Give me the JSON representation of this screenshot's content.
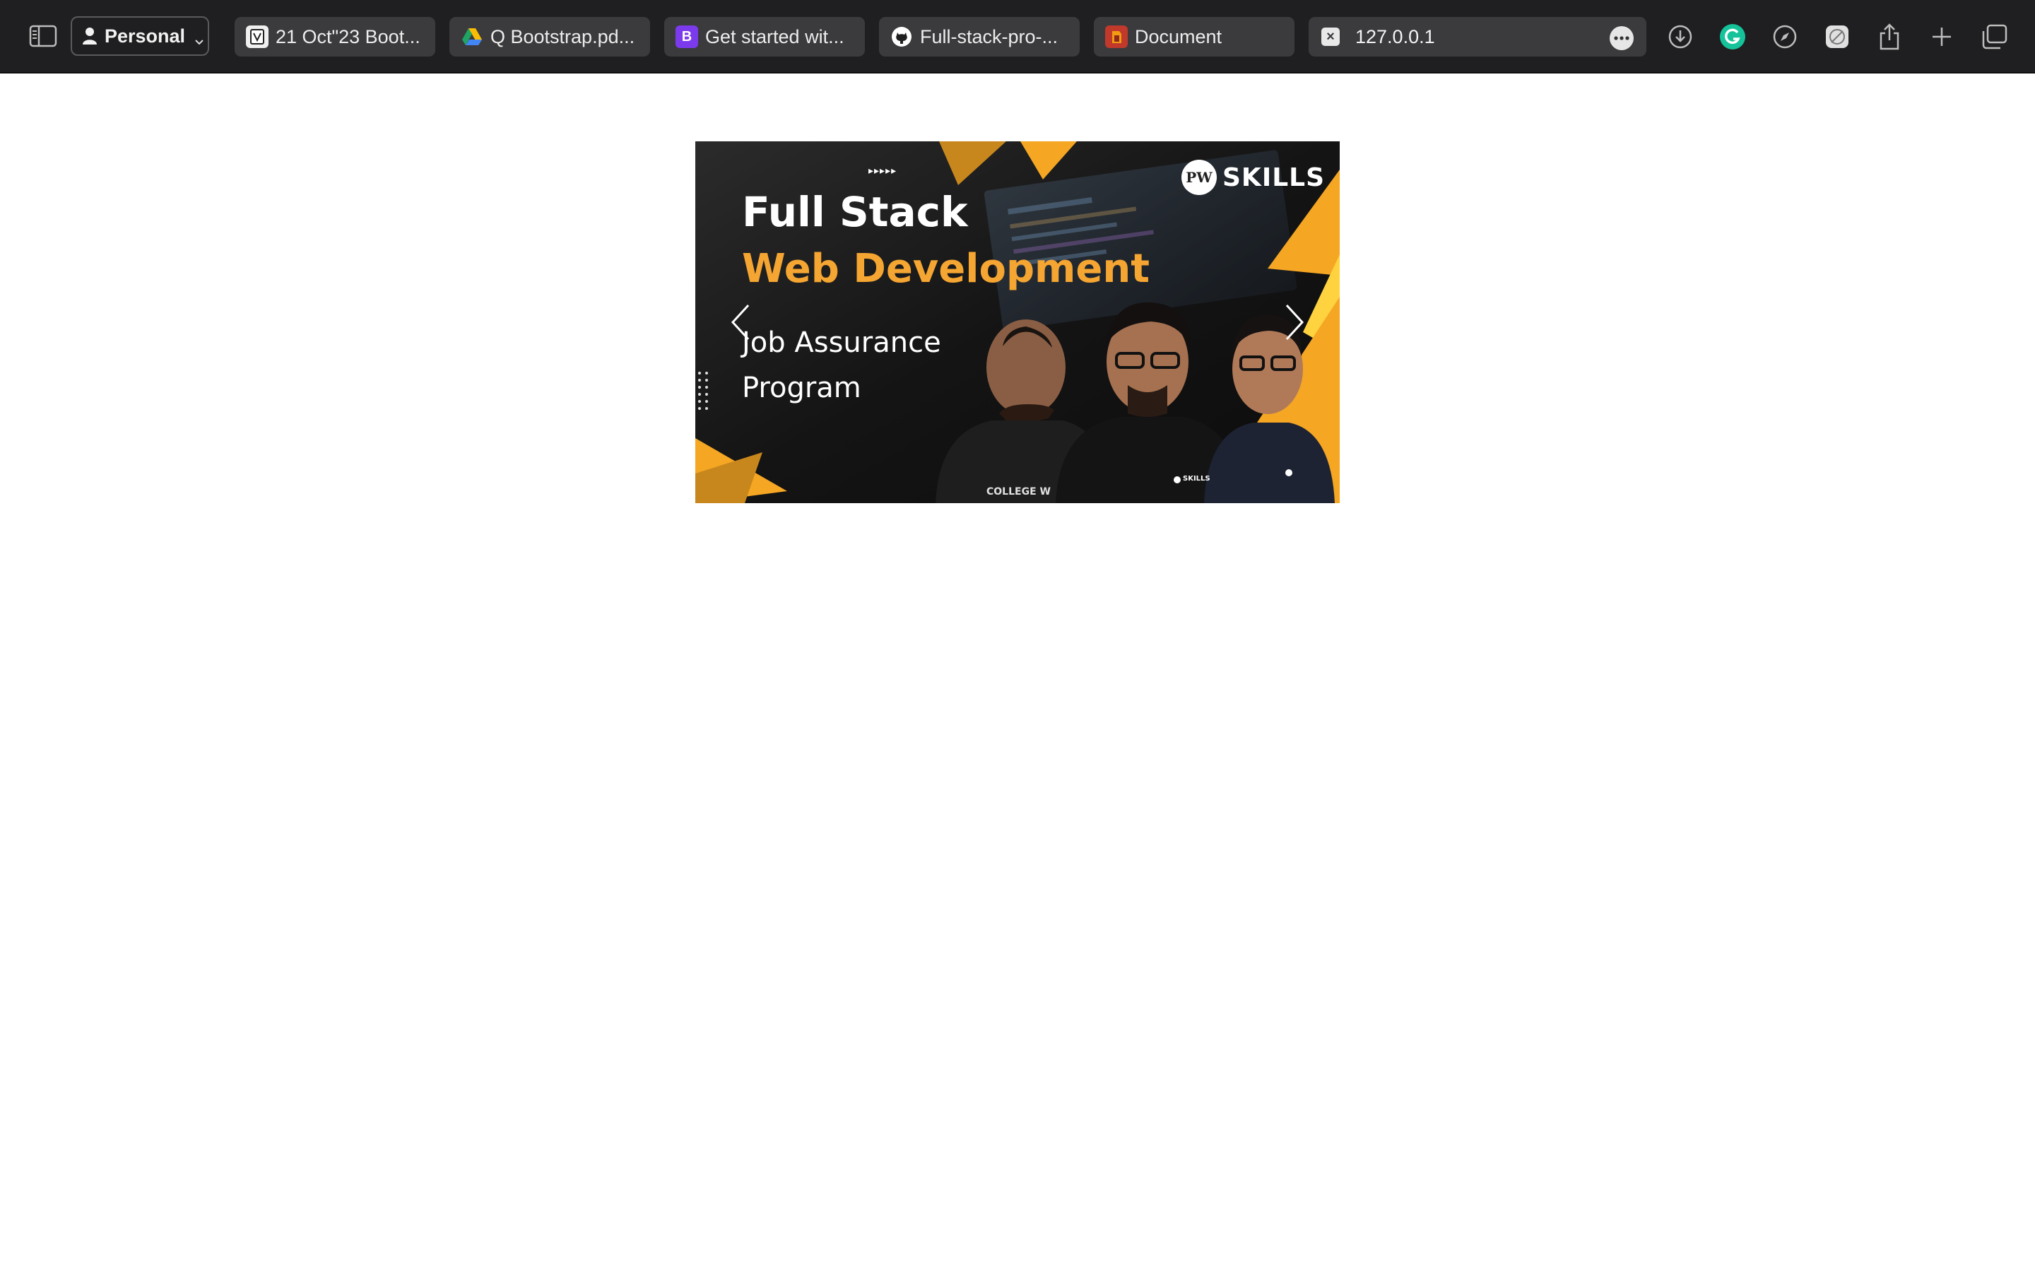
{
  "browser": {
    "profile_label": "Personal",
    "tabs": [
      {
        "label": "21 Oct\"23 Boot...",
        "icon": "file-icon"
      },
      {
        "label": "Q Bootstrap.pd...",
        "icon": "google-drive-icon"
      },
      {
        "label": "Get started wit...",
        "icon": "bootstrap-icon"
      },
      {
        "label": "Full-stack-pro-...",
        "icon": "github-icon"
      },
      {
        "label": "Document",
        "icon": "document-icon"
      }
    ],
    "address": "127.0.0.1",
    "toolbar_icons": [
      "download-icon",
      "grammarly-icon",
      "compass-icon",
      "extension-icon",
      "share-icon",
      "new-tab-icon",
      "tab-overview-icon"
    ]
  },
  "carousel": {
    "slide": {
      "title_line1": "Full Stack",
      "title_line2": "Web Development",
      "subtitle_line1": "Job Assurance",
      "subtitle_line2": "Program",
      "brand": "SKILLS",
      "brand_mark": "PW",
      "arrows_mark": "▸▸▸▸▸",
      "shirt_text": "COLLEGE W",
      "badge_text": "SKILLS"
    },
    "colors": {
      "accent": "#f5a623",
      "accent_dark": "#c8871c",
      "title": "#ffffff",
      "highlight": "#f5a531"
    }
  }
}
